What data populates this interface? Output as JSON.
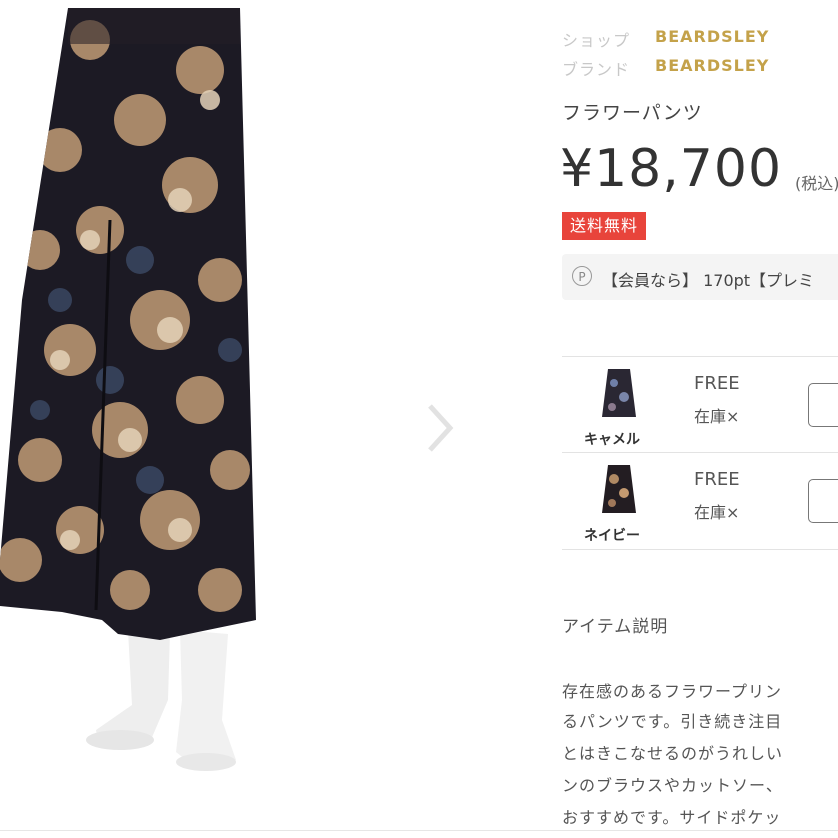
{
  "shop": {
    "label": "ショップ",
    "value": "BEARDSLEY"
  },
  "brand": {
    "label": "ブランド",
    "value": "BEARDSLEY"
  },
  "product": {
    "name": "フラワーパンツ",
    "price": "¥18,700",
    "tax_note": "(税込)",
    "shipping_badge": "送料無料",
    "points_icon": "P",
    "points_text": "【会員なら】 170pt【プレミ"
  },
  "variants": [
    {
      "color": "キャメル",
      "size": "FREE",
      "stock": "在庫×"
    },
    {
      "color": "ネイビー",
      "size": "FREE",
      "stock": "在庫×"
    }
  ],
  "description": {
    "title": "アイテム説明",
    "lines": [
      "存在感のあるフラワープリン",
      "るパンツです。引き続き注目",
      "とはきこなせるのがうれしい",
      "ンのブラウスやカットソー、",
      "おすすめです。サイドポケッ"
    ]
  },
  "icons": {
    "next": "chevron-right-icon",
    "points": "point-icon"
  },
  "colors": {
    "brand_gold": "#c4a24a",
    "badge_red": "#e8443b"
  }
}
